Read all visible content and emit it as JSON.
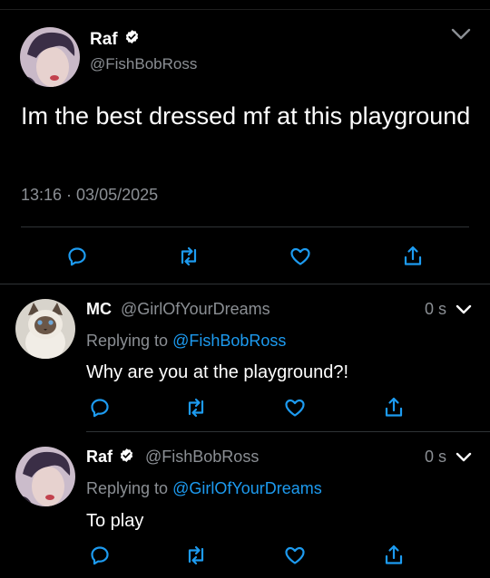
{
  "main_tweet": {
    "name": "Raf",
    "handle": "@FishBobRoss",
    "text": "Im the best dressed mf at this playground",
    "timestamp": "13:16 · 03/05/2025"
  },
  "replies": [
    {
      "name": "MC",
      "handle": "@GirlOfYourDreams",
      "time": "0 s",
      "replying_prefix": "Replying to",
      "replying_to": "@FishBobRoss",
      "text": "Why are you at the playground?!"
    },
    {
      "name": "Raf",
      "handle": "@FishBobRoss",
      "time": "0 s",
      "replying_prefix": "Replying to",
      "replying_to": "@GirlOfYourDreams",
      "text": "To play"
    }
  ],
  "icons": [
    "reply-icon",
    "retweet-icon",
    "like-icon",
    "share-icon",
    "verified-icon",
    "chevron-down-icon"
  ],
  "colors": {
    "background": "#000000",
    "secondary_text": "#8b8f94",
    "link": "#1d9bf0",
    "divider": "#2f3336"
  }
}
